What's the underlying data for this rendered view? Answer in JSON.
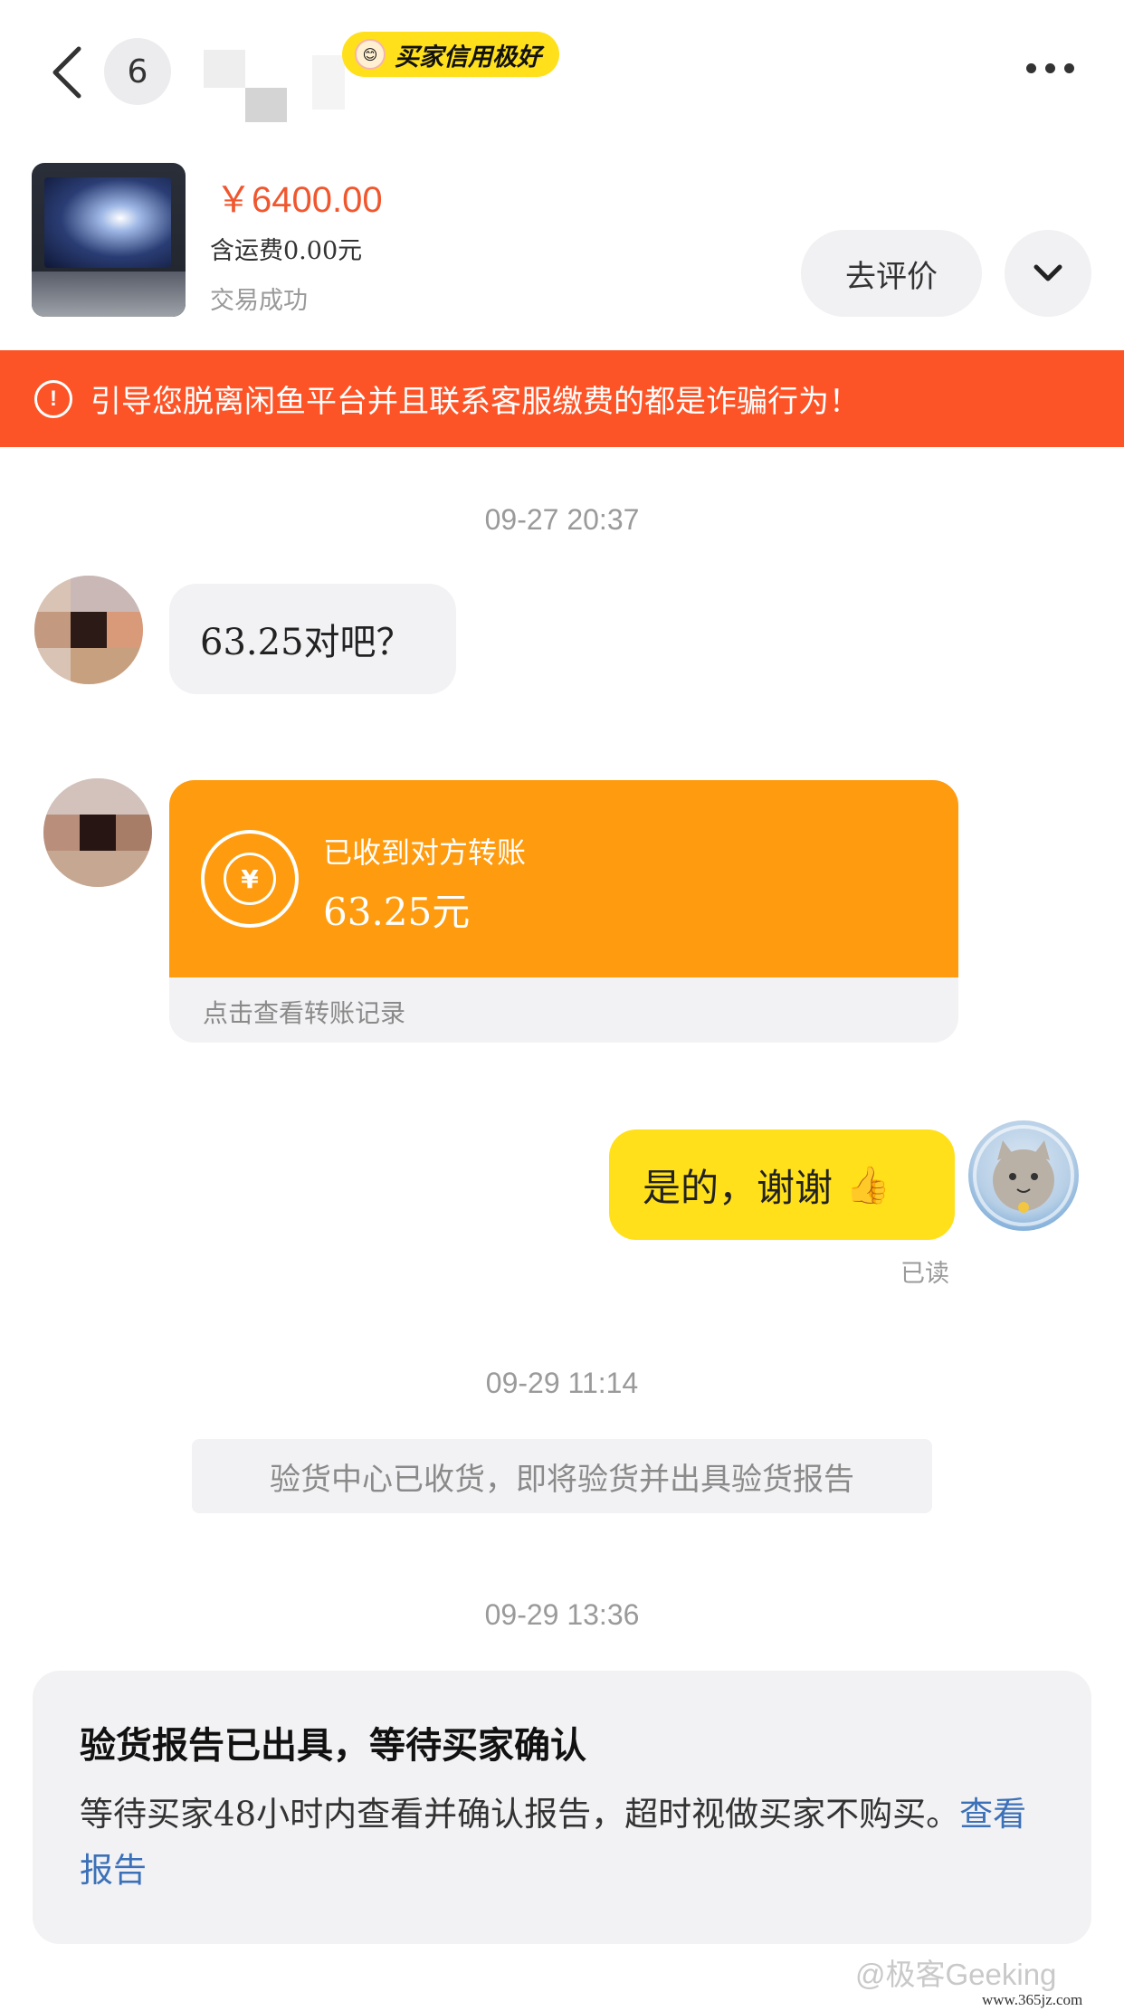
{
  "header": {
    "back_icon": "chevron-left-icon",
    "unread_count": "6",
    "credit_tag": "买家信用极好",
    "more_icon": "more-horizontal-icon"
  },
  "product": {
    "price": "￥6400.00",
    "shipping": "含运费0.00元",
    "status": "交易成功",
    "review_button": "去评价",
    "expand_icon": "chevron-down-icon"
  },
  "warning": {
    "icon": "alert-circle-icon",
    "text": "引导您脱离闲鱼平台并且联系客服缴费的都是诈骗行为！",
    "color": "#fd5427"
  },
  "chat": {
    "timestamp_1": "09-27 20:37",
    "msg_1": "63.25对吧？",
    "transfer": {
      "title": "已收到对方转账",
      "amount": "63.25元",
      "link": "点击查看转账记录",
      "color": "#ff9b0e"
    },
    "msg_2": "是的，谢谢",
    "msg_2_emoji": "👍",
    "read_status": "已读",
    "timestamp_2": "09-29 11:14",
    "system_notice": "验货中心已收货，即将验货并出具验货报告",
    "timestamp_3": "09-29 13:36",
    "report": {
      "title": "验货报告已出具，等待买家确认",
      "body": "等待买家48小时内查看并确认报告，超时视做买家不购买。",
      "link": "查看报告"
    }
  },
  "watermark": {
    "text": "@极客Geeking",
    "site": "www.365jz.com"
  },
  "colors": {
    "accent_yellow": "#ffe01b",
    "price_red": "#f0572e",
    "link_blue": "#3c70b8"
  }
}
